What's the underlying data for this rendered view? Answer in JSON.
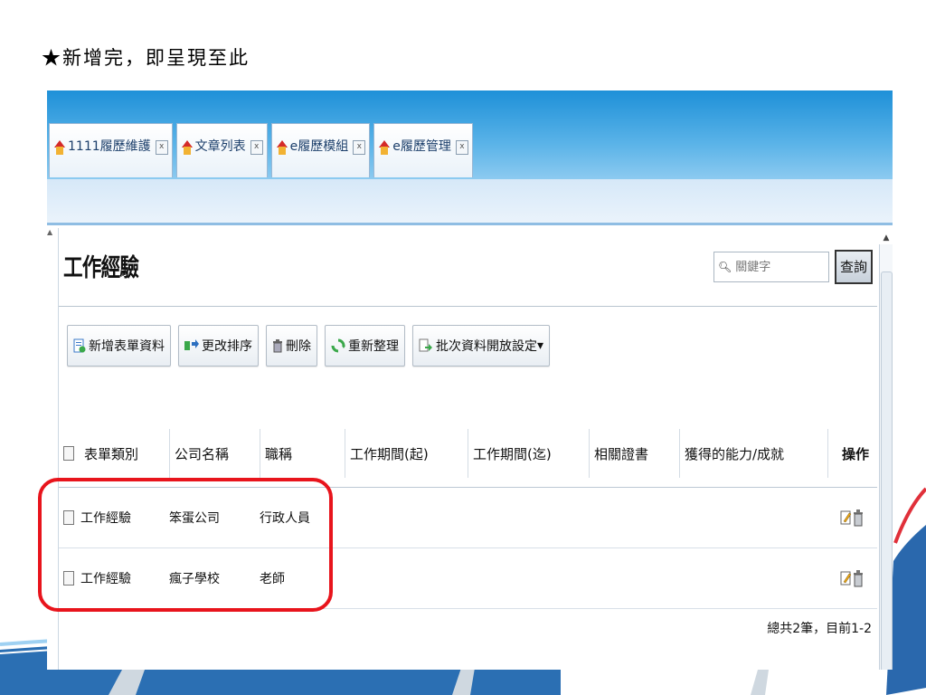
{
  "caption": "★新增完，即呈現至此",
  "tabs": [
    {
      "label": "1111履歷維護",
      "close": "x"
    },
    {
      "label": "文章列表",
      "close": "x"
    },
    {
      "label": "e履歷模組",
      "close": "x"
    },
    {
      "label": "e履歷管理",
      "close": "x"
    }
  ],
  "page": {
    "title": "工作經驗",
    "search_placeholder": "關鍵字",
    "search_button": "查詢"
  },
  "toolbar": {
    "add": "新增表單資料",
    "reorder": "更改排序",
    "delete": "刪除",
    "reorganize": "重新整理",
    "batch": "批次資料開放設定",
    "batch_arrow": "▾"
  },
  "table": {
    "headers": [
      "表單類別",
      "公司名稱",
      "職稱",
      "工作期間(起)",
      "工作期間(迄)",
      "相關證書",
      "獲得的能力/成就",
      "操作"
    ],
    "rows": [
      {
        "category": "工作經驗",
        "company": "笨蛋公司",
        "title": "行政人員"
      },
      {
        "category": "工作經驗",
        "company": "瘋子學校",
        "title": "老師"
      }
    ],
    "footer": "總共2筆，目前1-2"
  },
  "colors": {
    "accent_red": "#e8141c",
    "tab_blue": "#1e90d8"
  }
}
